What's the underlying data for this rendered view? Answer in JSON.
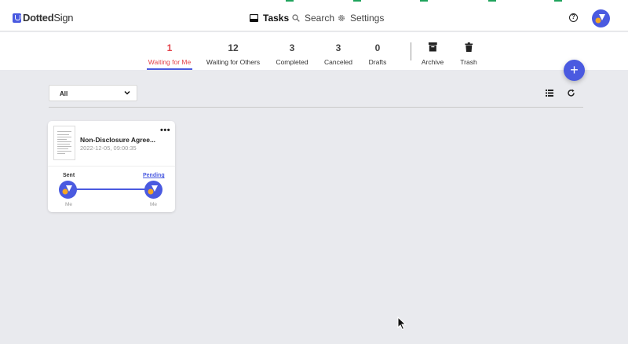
{
  "app": {
    "logo_text_bold": "Dotted",
    "logo_text_light": "Sign"
  },
  "nav": {
    "tasks": "Tasks",
    "search": "Search",
    "settings": "Settings"
  },
  "tabs": [
    {
      "count": "1",
      "label": "Waiting for Me",
      "active": true
    },
    {
      "count": "12",
      "label": "Waiting for Others"
    },
    {
      "count": "3",
      "label": "Completed"
    },
    {
      "count": "3",
      "label": "Canceled"
    },
    {
      "count": "0",
      "label": "Drafts"
    }
  ],
  "extra_tabs": [
    {
      "label": "Archive",
      "icon": "archive-icon"
    },
    {
      "label": "Trash",
      "icon": "trash-icon"
    }
  ],
  "filter": {
    "selected": "All"
  },
  "help_symbol": "?",
  "fab_symbol": "+",
  "card": {
    "title": "Non-Disclosure Agree...",
    "date": "2022-12-05, 09:00:35",
    "menu": "•••",
    "sent_label": "Sent",
    "pending_label": "Pending",
    "signers": [
      "Me",
      "Me"
    ]
  },
  "colors": {
    "accent": "#4a5ae0",
    "active_tab": "#e3424a",
    "avatar_dot": "#f5a623"
  }
}
